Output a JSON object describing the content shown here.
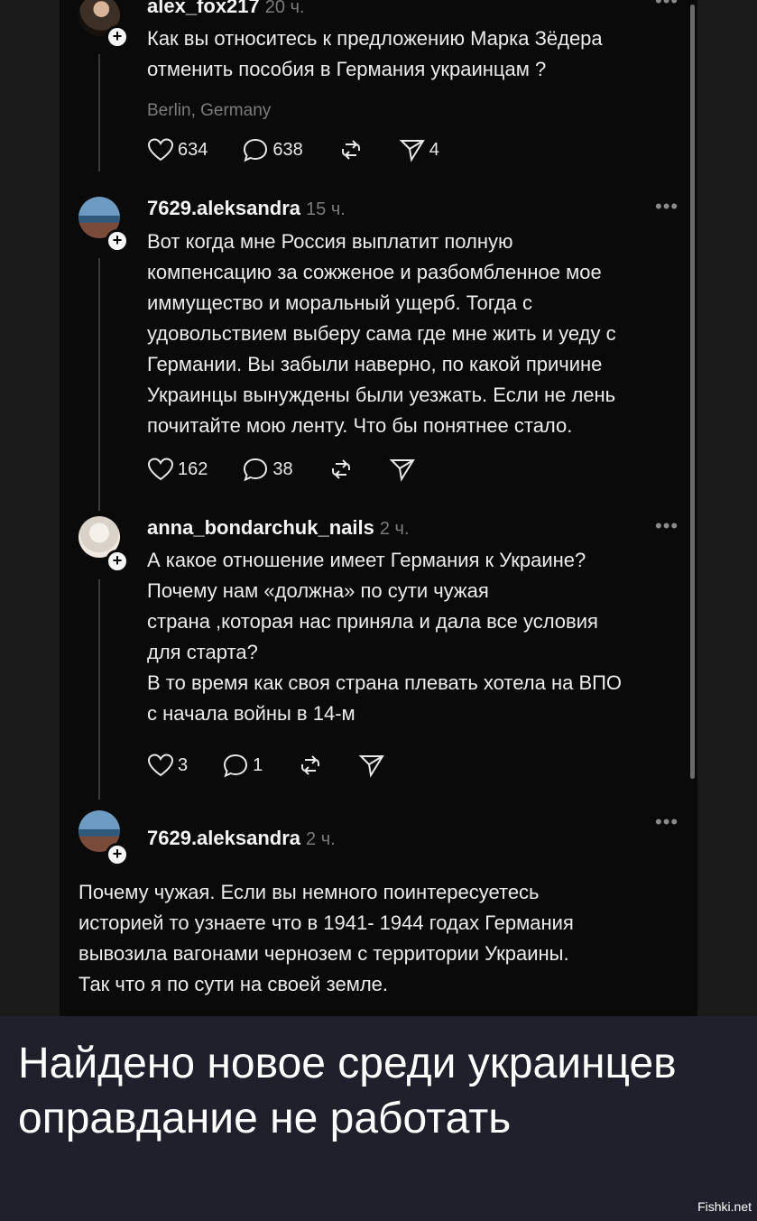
{
  "posts": [
    {
      "username": "alex_fox217",
      "time": "20 ч.",
      "text": "Как вы относитесь к предложению  Марка Зёдера\nотменить пособия в Германия украинцам ?",
      "location": "Berlin, Germany",
      "likes": "634",
      "replies": "638",
      "shares": "4"
    },
    {
      "username": "7629.aleksandra",
      "time": "15 ч.",
      "text": "Вот когда мне Россия выплатит полную\nкомпенсацию за сожженое и разбомбленное мое\nиммущество и моральный ущерб. Тогда с\nудовольствием выберу сама где мне жить и уеду с\nГермании.  Вы забыли наверно, по какой причине\nУкраинцы вынуждены были уезжать.  Если не лень\nпочитайте мою ленту.  Что бы понятнее стало.",
      "likes": "162",
      "replies": "38"
    },
    {
      "username": "anna_bondarchuk_nails",
      "time": "2 ч.",
      "text": "А какое отношение имеет Германия к Украине?\nПочему нам «должна» по сути чужая\nстрана ,которая нас приняла и дала все условия\nдля старта?\nВ то время как своя страна плевать хотела на ВПО\nс начала войны в 14-м",
      "likes": "3",
      "replies": "1"
    },
    {
      "username": "7629.aleksandra",
      "time": "2 ч.",
      "text": "Почему чужая. Если вы немного поинтересуетесь\nисторией то узнаете что в 1941- 1944 годах Германия\nвывозила вагонами чернозем с территории Украины.\nТак что я по сути на своей земле."
    }
  ],
  "caption": "Найдено новое среди украинцев\nоправдание не работать",
  "watermark": "Fishki.net",
  "icons": [
    "heart-icon",
    "comment-icon",
    "repost-icon",
    "send-icon",
    "plus-icon",
    "more-icon"
  ]
}
